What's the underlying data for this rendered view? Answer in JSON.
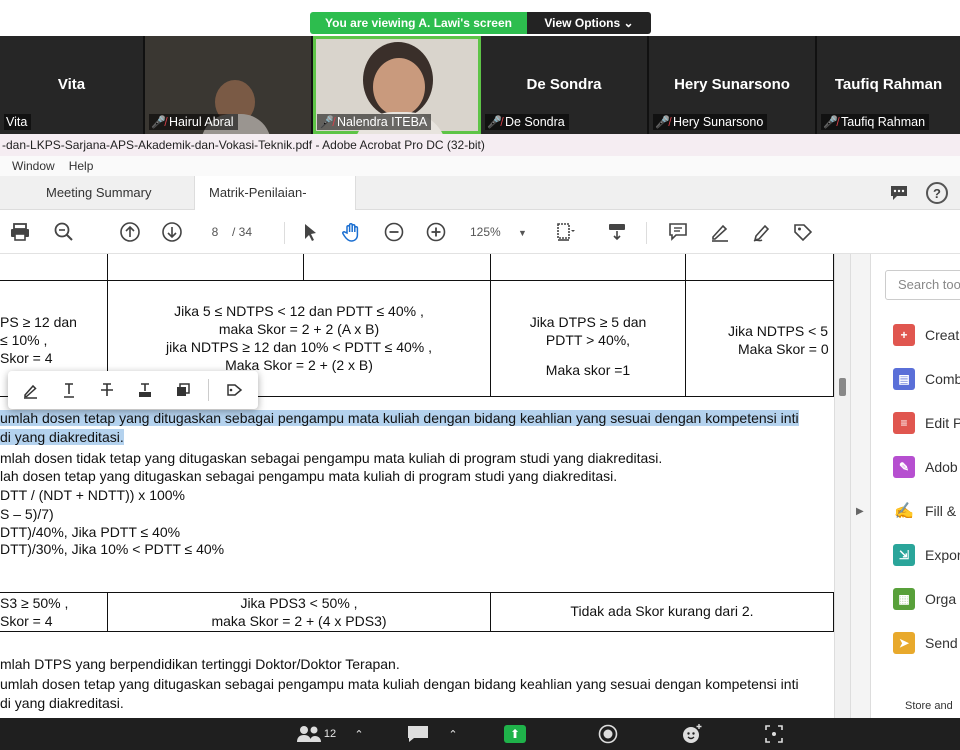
{
  "zoom": {
    "share_banner": "You are viewing A. Lawi's screen",
    "view_options": "View Options",
    "participants": [
      {
        "big_name": "Vita",
        "label": "Vita",
        "muted": false
      },
      {
        "big_name": "",
        "label": "Hairul Abral",
        "muted": true
      },
      {
        "big_name": "",
        "label": "Nalendra ITEBA",
        "muted": true
      },
      {
        "big_name": "De Sondra",
        "label": "De Sondra",
        "muted": true
      },
      {
        "big_name": "Hery Sunarsono",
        "label": "Hery Sunarsono",
        "muted": true
      },
      {
        "big_name": "Taufiq Rahman",
        "label": "Taufiq Rahman",
        "muted": true
      }
    ],
    "bottom_bar": {
      "participant_count": "12"
    }
  },
  "acrobat": {
    "window_title": "-dan-LKPS-Sarjana-APS-Akademik-dan-Vokasi-Teknik.pdf - Adobe Acrobat Pro DC (32-bit)",
    "menu": [
      "Window",
      "Help"
    ],
    "tabs": [
      {
        "label": "Meeting Summary"
      },
      {
        "label": "Matrik-Penilaian-LE...",
        "close": "×"
      }
    ],
    "toolbar": {
      "page_current": "8",
      "page_total": "/ 34",
      "zoom": "125%"
    },
    "right_panel": {
      "search_placeholder": "Search too",
      "items": [
        {
          "label": "Creat",
          "color": "#e0564f",
          "icon": "create-pdf-icon"
        },
        {
          "label": "Comb",
          "color": "#5a6fd8",
          "icon": "combine-files-icon"
        },
        {
          "label": "Edit P",
          "color": "#e0564f",
          "icon": "edit-pdf-icon"
        },
        {
          "label": "Adob",
          "color": "#b64fd0",
          "icon": "adobe-sign-icon"
        },
        {
          "label": "Fill &",
          "color": "#7b55d6",
          "icon": "fill-sign-icon"
        },
        {
          "label": "Expor",
          "color": "#2aa59a",
          "icon": "export-pdf-icon"
        },
        {
          "label": "Orga",
          "color": "#58a03a",
          "icon": "organize-pages-icon"
        },
        {
          "label": "Send",
          "color": "#e8a92c",
          "icon": "send-review-icon"
        }
      ],
      "store": "Store and"
    }
  },
  "document": {
    "table1": {
      "c1": [
        "PS ≥ 12 dan",
        "≤ 10% ,",
        "Skor = 4"
      ],
      "c2": [
        "Jika 5 ≤ NDTPS < 12 dan PDTT ≤ 40% ,",
        "maka Skor = 2 + 2 (A x B)",
        "jika NDTPS ≥ 12 dan 10% < PDTT ≤ 40% ,",
        "Maka Skor = 2 + (2 x B)"
      ],
      "c3": [
        "Jika DTPS ≥ 5 dan",
        "PDTT > 40%,",
        "Maka skor =1"
      ],
      "c4": [
        "Jika NDTPS < 5",
        "Maka Skor = 0"
      ]
    },
    "para1": [
      "umlah dosen tetap yang ditugaskan sebagai pengampu mata kuliah dengan bidang keahlian yang sesuai dengan kompetensi inti",
      "di yang diakreditasi.",
      "mlah dosen tidak tetap yang ditugaskan sebagai pengampu mata kuliah di program studi yang diakreditasi.",
      "lah dosen tetap yang ditugaskan sebagai pengampu mata kuliah di program studi yang diakreditasi.",
      "DTT / (NDT + NDTT)) x 100%",
      "S – 5)/7)",
      "DTT)/40%, Jika PDTT ≤ 40%",
      "DTT)/30%, Jika 10% < PDTT ≤ 40%"
    ],
    "table2": {
      "c1": [
        "S3 ≥ 50% ,",
        "Skor = 4"
      ],
      "c2": [
        "Jika PDS3 < 50% ,",
        "maka Skor = 2 + (4 x PDS3)"
      ],
      "c3": [
        "Tidak ada Skor kurang dari 2."
      ]
    },
    "para2": [
      "mlah DTPS yang berpendidikan tertinggi Doktor/Doktor Terapan.",
      "umlah dosen tetap yang ditugaskan sebagai pengampu mata kuliah dengan bidang keahlian yang sesuai dengan kompetensi inti",
      "di yang diakreditasi."
    ]
  }
}
